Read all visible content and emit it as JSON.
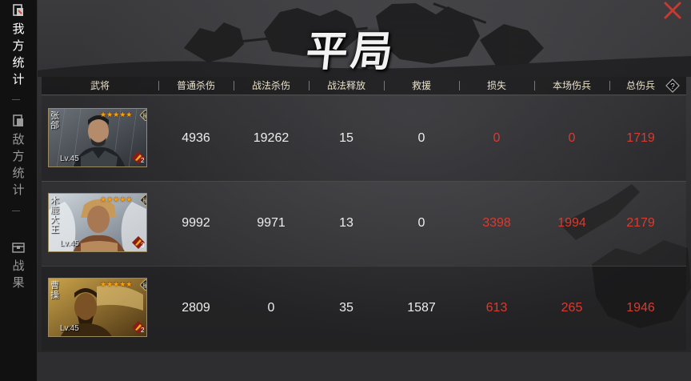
{
  "title": "平局",
  "sidebar": [
    {
      "label": "我方统计",
      "icon": "document-icon",
      "active": true
    },
    {
      "label": "敌方统计",
      "icon": "document-icon",
      "active": false
    },
    {
      "label": "战果",
      "icon": "chest-icon",
      "active": false
    }
  ],
  "header": {
    "general": "武将",
    "normal_damage": "普通杀伤",
    "tactic_damage": "战法杀伤",
    "tactic_casts": "战法释放",
    "rescue": "救援",
    "loss": "损失",
    "wounded": "本场伤兵",
    "total_wounded": "总伤兵",
    "help": "?"
  },
  "rows": [
    {
      "name": "张郃",
      "level": "Lv.45",
      "stars": "★★★★★",
      "badge": "2",
      "normal_damage": "4936",
      "tactic_damage": "19262",
      "tactic_casts": "15",
      "rescue": "0",
      "loss": "0",
      "wounded": "0",
      "total_wounded": "1719"
    },
    {
      "name": "木鹿大王",
      "level": "Lv.45",
      "stars": "★★★★★",
      "badge": "3",
      "normal_damage": "9992",
      "tactic_damage": "9971",
      "tactic_casts": "13",
      "rescue": "0",
      "loss": "3398",
      "wounded": "1994",
      "total_wounded": "2179"
    },
    {
      "name": "曹操",
      "level": "Lv.45",
      "stars": "★★★★★",
      "badge": "2",
      "normal_damage": "2809",
      "tactic_damage": "0",
      "tactic_casts": "35",
      "rescue": "1587",
      "loss": "613",
      "wounded": "265",
      "total_wounded": "1946"
    }
  ],
  "colors": {
    "loss_red": "#d83b2f",
    "star_gold": "#f2a31b"
  }
}
